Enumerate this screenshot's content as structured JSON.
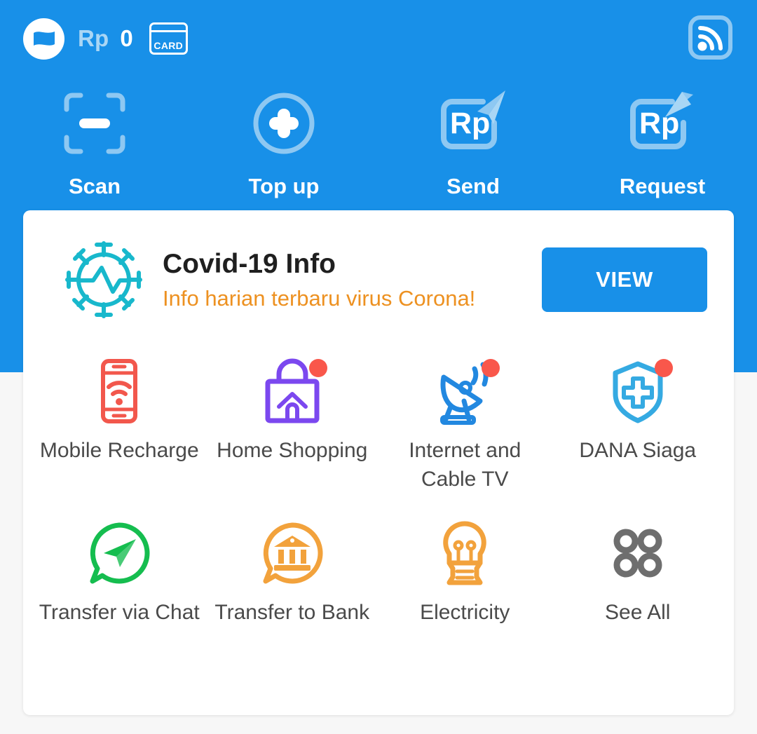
{
  "app": {
    "name": "DANA",
    "brand_color": "#1890e8",
    "background_color": "#f7f7f7",
    "card_color": "#ffffff"
  },
  "header": {
    "wallet_icon": "dana-wallet-logo",
    "currency": "Rp",
    "balance": "0",
    "card_badge": {
      "icon": "credit-card-icon",
      "label": "CARD"
    },
    "feed_icon": "rss-feed-icon"
  },
  "quick_actions": [
    {
      "label": "Scan",
      "icon": "qr-scan-icon"
    },
    {
      "label": "Top up",
      "icon": "plus-circle-icon"
    },
    {
      "label": "Send",
      "icon": "send-money-icon"
    },
    {
      "label": "Request",
      "icon": "request-money-icon"
    }
  ],
  "covid_banner": {
    "icon": "coronavirus-icon",
    "icon_color": "#18b8cc",
    "title": "Covid-19 Info",
    "subtitle": "Info harian terbaru virus Corona!",
    "subtitle_color": "#ed9121",
    "button_label": "VIEW",
    "button_color": "#1890e8"
  },
  "services": [
    {
      "label": "Mobile Recharge",
      "icon": "phone-signal-icon",
      "color": "#f2574c",
      "badge": false
    },
    {
      "label": "Home Shopping",
      "icon": "shopping-bag-house-icon",
      "color": "#7b48ef",
      "badge": true
    },
    {
      "label": "Internet and Cable TV",
      "icon": "satellite-dish-icon",
      "color": "#2288e0",
      "badge": true
    },
    {
      "label": "DANA Siaga",
      "icon": "shield-cross-icon",
      "color": "#35aae2",
      "badge": true
    },
    {
      "label": "Transfer via Chat",
      "icon": "chat-send-icon",
      "color": "#15bd4f",
      "badge": false
    },
    {
      "label": "Transfer to Bank",
      "icon": "chat-bank-icon",
      "color": "#f2a23c",
      "badge": false
    },
    {
      "label": "Electricity",
      "icon": "light-bulb-icon",
      "color": "#f2a23c",
      "badge": false
    },
    {
      "label": "See All",
      "icon": "grid-dots-icon",
      "color": "#6e6e6e",
      "badge": false
    }
  ]
}
